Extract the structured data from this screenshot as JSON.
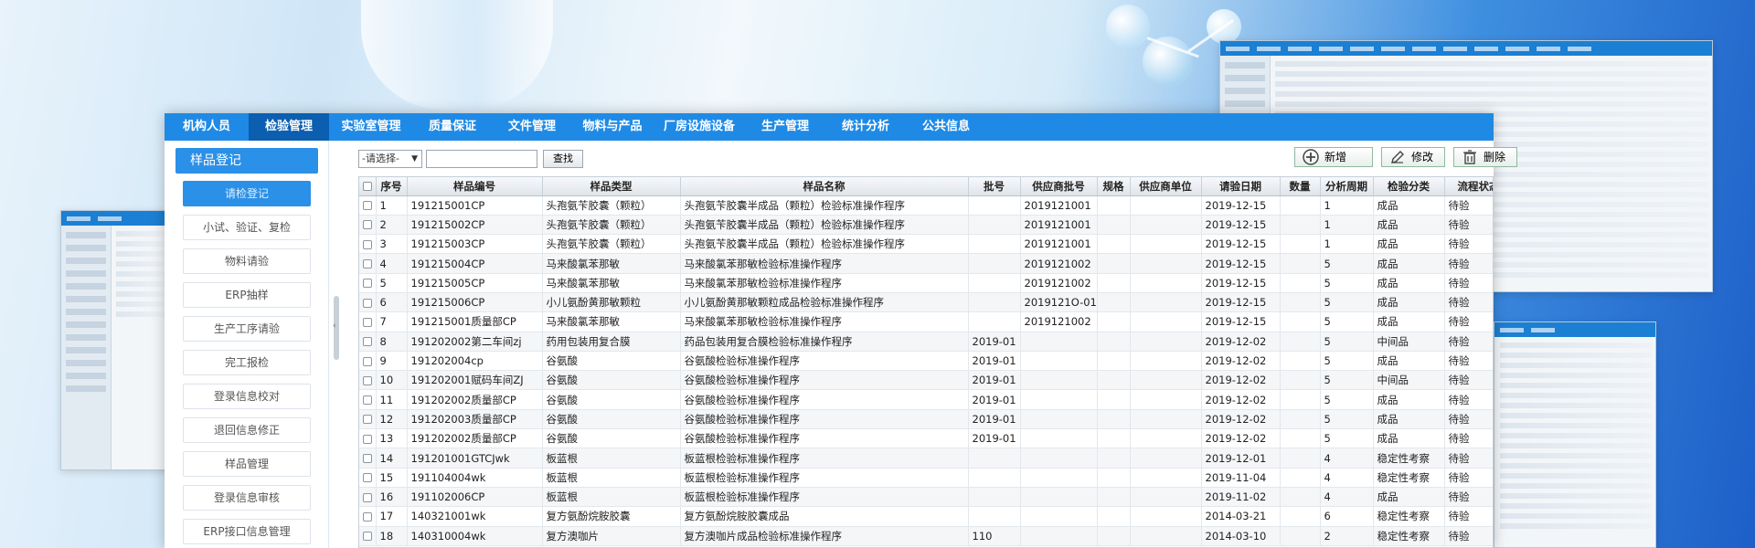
{
  "nav": [
    {
      "label": "机构人员",
      "active": false
    },
    {
      "label": "检验管理",
      "active": true
    },
    {
      "label": "实验室管理",
      "active": false
    },
    {
      "label": "质量保证",
      "active": false
    },
    {
      "label": "文件管理",
      "active": false
    },
    {
      "label": "物料与产品",
      "active": false
    },
    {
      "label": "厂房设施设备",
      "active": false
    },
    {
      "label": "生产管理",
      "active": false
    },
    {
      "label": "统计分析",
      "active": false
    },
    {
      "label": "公共信息",
      "active": false
    }
  ],
  "sidebar": {
    "header": "样品登记",
    "items": [
      {
        "label": "请检登记",
        "active": true
      },
      {
        "label": "小试、验证、复检",
        "active": false
      },
      {
        "label": "物料请验",
        "active": false
      },
      {
        "label": "ERP抽样",
        "active": false
      },
      {
        "label": "生产工序请验",
        "active": false
      },
      {
        "label": "完工报检",
        "active": false
      },
      {
        "label": "登录信息校对",
        "active": false
      },
      {
        "label": "退回信息修正",
        "active": false
      },
      {
        "label": "样品管理",
        "active": false
      },
      {
        "label": "登录信息审核",
        "active": false
      },
      {
        "label": "ERP接口信息管理",
        "active": false
      }
    ]
  },
  "toolbar": {
    "select_value": "-请选择-",
    "search_value": "",
    "search_label": "查找",
    "add_label": "新增",
    "edit_label": "修改",
    "delete_label": "删除"
  },
  "table": {
    "headers": [
      "序号",
      "样品编号",
      "样品类型",
      "样品名称",
      "批号",
      "供应商批号",
      "规格",
      "供应商单位",
      "请验日期",
      "数量",
      "分析周期",
      "检验分类",
      "流程状态"
    ],
    "rows": [
      [
        "1",
        "191215001CP",
        "头孢氨苄胶囊（颗粒）",
        "头孢氨苄胶囊半成品（颗粒）检验标准操作程序",
        "",
        "2019121001",
        "",
        "",
        "2019-12-15",
        "",
        "1",
        "成品",
        "待验"
      ],
      [
        "2",
        "191215002CP",
        "头孢氨苄胶囊（颗粒）",
        "头孢氨苄胶囊半成品（颗粒）检验标准操作程序",
        "",
        "2019121001",
        "",
        "",
        "2019-12-15",
        "",
        "1",
        "成品",
        "待验"
      ],
      [
        "3",
        "191215003CP",
        "头孢氨苄胶囊（颗粒）",
        "头孢氨苄胶囊半成品（颗粒）检验标准操作程序",
        "",
        "2019121001",
        "",
        "",
        "2019-12-15",
        "",
        "1",
        "成品",
        "待验"
      ],
      [
        "4",
        "191215004CP",
        "马来酸氯苯那敏",
        "马来酸氯苯那敏检验标准操作程序",
        "",
        "2019121002",
        "",
        "",
        "2019-12-15",
        "",
        "5",
        "成品",
        "待验"
      ],
      [
        "5",
        "191215005CP",
        "马来酸氯苯那敏",
        "马来酸氯苯那敏检验标准操作程序",
        "",
        "2019121002",
        "",
        "",
        "2019-12-15",
        "",
        "5",
        "成品",
        "待验"
      ],
      [
        "6",
        "191215006CP",
        "小儿氨酚黄那敏颗粒",
        "小儿氨酚黄那敏颗粒成品检验标准操作程序",
        "",
        "2019121O-01",
        "",
        "",
        "2019-12-15",
        "",
        "5",
        "成品",
        "待验"
      ],
      [
        "7",
        "191215001质量部CP",
        "马来酸氯苯那敏",
        "马来酸氯苯那敏检验标准操作程序",
        "",
        "2019121002",
        "",
        "",
        "2019-12-15",
        "",
        "5",
        "成品",
        "待验"
      ],
      [
        "8",
        "191202002第二车间zj",
        "药用包装用复合膜",
        "药品包装用复合膜检验标准操作程序",
        "2019-01",
        "",
        "",
        "",
        "2019-12-02",
        "",
        "5",
        "中间品",
        "待验"
      ],
      [
        "9",
        "191202004cp",
        "谷氨酸",
        "谷氨酸检验标准操作程序",
        "2019-01",
        "",
        "",
        "",
        "2019-12-02",
        "",
        "5",
        "成品",
        "待验"
      ],
      [
        "10",
        "191202001赋码车间ZJ",
        "谷氨酸",
        "谷氨酸检验标准操作程序",
        "2019-01",
        "",
        "",
        "",
        "2019-12-02",
        "",
        "5",
        "中间品",
        "待验"
      ],
      [
        "11",
        "191202002质量部CP",
        "谷氨酸",
        "谷氨酸检验标准操作程序",
        "2019-01",
        "",
        "",
        "",
        "2019-12-02",
        "",
        "5",
        "成品",
        "待验"
      ],
      [
        "12",
        "191202003质量部CP",
        "谷氨酸",
        "谷氨酸检验标准操作程序",
        "2019-01",
        "",
        "",
        "",
        "2019-12-02",
        "",
        "5",
        "成品",
        "待验"
      ],
      [
        "13",
        "191202002质量部CP",
        "谷氨酸",
        "谷氨酸检验标准操作程序",
        "2019-01",
        "",
        "",
        "",
        "2019-12-02",
        "",
        "5",
        "成品",
        "待验"
      ],
      [
        "14",
        "191201001GTCJwk",
        "板蓝根",
        "板蓝根检验标准操作程序",
        "",
        "",
        "",
        "",
        "2019-12-01",
        "",
        "4",
        "稳定性考察",
        "待验"
      ],
      [
        "15",
        "191104004wk",
        "板蓝根",
        "板蓝根检验标准操作程序",
        "",
        "",
        "",
        "",
        "2019-11-04",
        "",
        "4",
        "稳定性考察",
        "待验"
      ],
      [
        "16",
        "191102006CP",
        "板蓝根",
        "板蓝根检验标准操作程序",
        "",
        "",
        "",
        "",
        "2019-11-02",
        "",
        "4",
        "成品",
        "待验"
      ],
      [
        "17",
        "140321001wk",
        "复方氨酚烷胺胶囊",
        "复方氨酚烷胺胶囊成品",
        "",
        "",
        "",
        "",
        "2014-03-21",
        "",
        "6",
        "稳定性考察",
        "待验"
      ],
      [
        "18",
        "140310004wk",
        "复方澳咖片",
        "复方澳咖片成品检验标准操作程序",
        "110",
        "",
        "",
        "",
        "2014-03-10",
        "",
        "2",
        "稳定性考察",
        "待验"
      ]
    ]
  },
  "colors": {
    "nav_bg": "#1f8ae6",
    "nav_active": "#0b5eb0",
    "sidebar_active": "#2b90e8"
  }
}
